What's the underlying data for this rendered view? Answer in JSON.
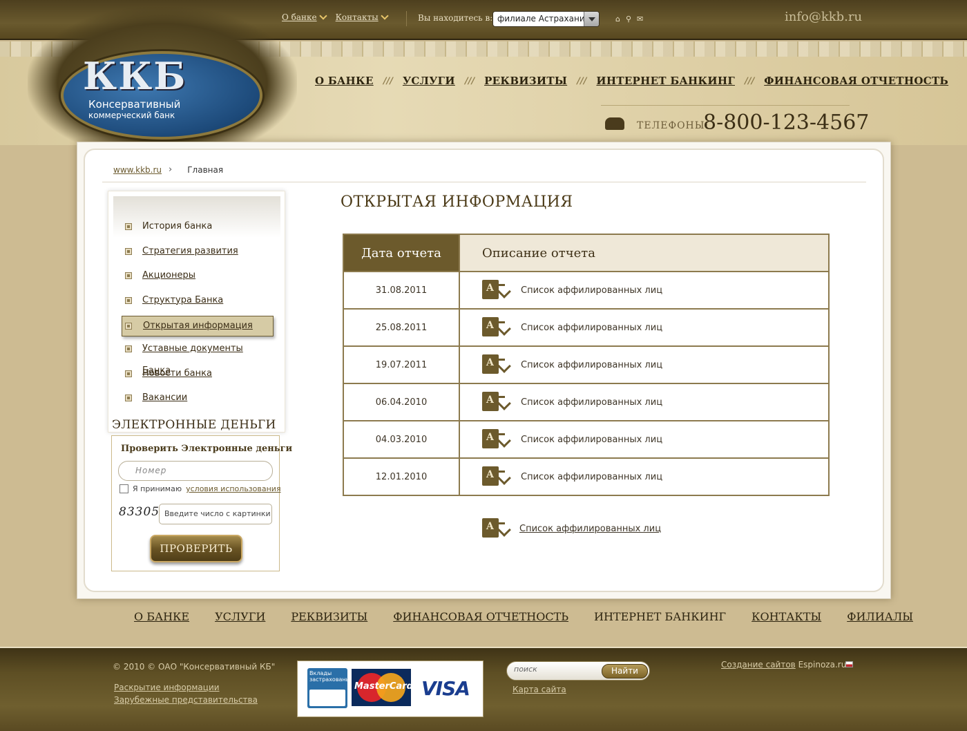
{
  "topbar": {
    "links": [
      "О банке",
      "Контакты"
    ],
    "location_label": "Вы находитесь в:",
    "location_value": "филиале Астрахани",
    "email": "info@kkb.ru"
  },
  "logo": {
    "abbr": "ККБ",
    "line1": "Консервативный",
    "line2": "коммерческий банк"
  },
  "main_nav": [
    "О БАНКЕ",
    "УСЛУГИ",
    "РЕКВИЗИТЫ",
    "ИНТЕРНЕТ БАНКИНГ",
    "ФИНАНСОВАЯ ОТЧЕТНОСТЬ"
  ],
  "main_nav_separator": "///",
  "phone": {
    "label": "ТЕЛЕФОНЫ:",
    "number": "8-800-123-4567"
  },
  "breadcrumb": {
    "home": "www.kkb.ru",
    "current": "Главная"
  },
  "sidebar": {
    "items": [
      {
        "label": "История банка",
        "link": false,
        "active": false
      },
      {
        "label": "Стратегия развития",
        "link": true,
        "active": false
      },
      {
        "label": "Акционеры",
        "link": true,
        "active": false
      },
      {
        "label": "Структура Банка",
        "link": true,
        "active": false
      },
      {
        "label": "Открытая информация",
        "link": true,
        "active": true
      },
      {
        "label": "Уставные документы Банка",
        "link": true,
        "active": false
      },
      {
        "label": "Новости банка",
        "link": true,
        "active": false
      },
      {
        "label": "Вакансии",
        "link": true,
        "active": false
      }
    ]
  },
  "emoney": {
    "title": "ЭЛЕКТРОННЫЕ ДЕНЬГИ",
    "heading": "Проверить Электронные деньги",
    "number_placeholder": "Номер",
    "agree_text": "Я принимаю",
    "terms_link": "условия использования",
    "captcha": "83305",
    "captcha_placeholder": "Введите число с картинки",
    "button": "ПРОВЕРИТЬ"
  },
  "page_title": "ОТКРЫТАЯ ИНФОРМАЦИЯ",
  "table": {
    "col_date": "Дата отчета",
    "col_desc": "Описание отчета",
    "rows": [
      {
        "date": "31.08.2011",
        "desc": "Список аффилированных лиц"
      },
      {
        "date": "25.08.2011",
        "desc": "Список аффилированных лиц"
      },
      {
        "date": "19.07.2011",
        "desc": "Список аффилированных лиц"
      },
      {
        "date": "06.04.2010",
        "desc": "Список аффилированных лиц"
      },
      {
        "date": "04.03.2010",
        "desc": "Список аффилированных лиц"
      },
      {
        "date": "12.01.2010",
        "desc": "Список аффилированных лиц"
      }
    ]
  },
  "bottom_link": "Список аффилированных лиц",
  "bottom_nav": [
    "О БАНКЕ",
    "УСЛУГИ",
    "РЕКВИЗИТЫ",
    "ФИНАНСОВАЯ ОТЧЕТНОСТЬ",
    "ИНТЕРНЕТ БАНКИНГ",
    "КОНТАКТЫ",
    "ФИЛИАЛЫ"
  ],
  "footer": {
    "copyright": "© 2010 © ОАО \"Консервативный КБ\"",
    "links": [
      "Раскрытие информации",
      "Зарубежные представительства"
    ],
    "insurance_badge": "Вклады застрахованы",
    "mastercard": "MasterCard",
    "visa": "VISA",
    "search_placeholder": "поиск",
    "search_button": "Найти",
    "sitemap": "Карта сайта",
    "created_link": "Создание сайтов",
    "created_by": "Espinoza.ru"
  },
  "colors": {
    "brand_dark": "#6c5a2c",
    "accent_gold": "#caa863",
    "logo_blue": "#1d4a7a"
  },
  "icons": [
    "chevron-down-icon",
    "home-icon",
    "search-icon",
    "mail-icon",
    "phone-icon",
    "pdf-download-icon"
  ]
}
